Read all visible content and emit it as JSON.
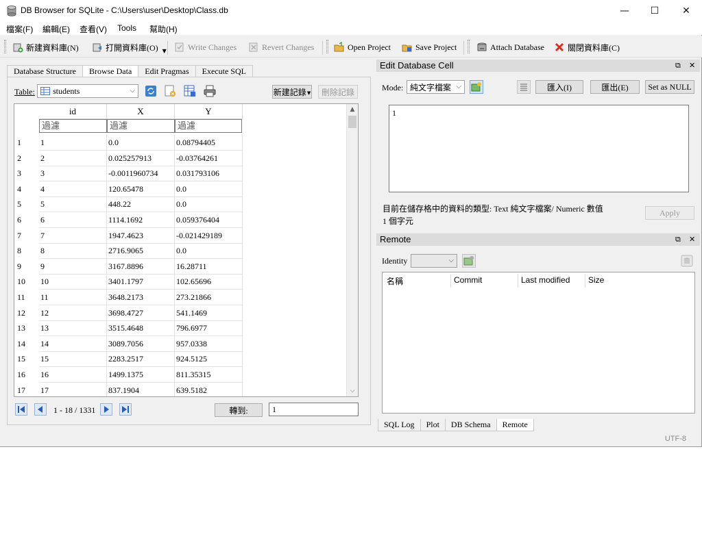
{
  "window": {
    "title": "DB Browser for SQLite - C:\\Users\\user\\Desktop\\Class.db",
    "minimize": "—",
    "maximize": "☐",
    "close": "✕"
  },
  "menu": [
    "檔案(F)",
    "編輯(E)",
    "查看(V)",
    "Tools",
    "幫助(H)"
  ],
  "toolbar": {
    "new_db": "新建資料庫(N)",
    "open_db": "打開資料庫(O)",
    "write_changes": "Write Changes",
    "revert_changes": "Revert Changes",
    "open_project": "Open Project",
    "save_project": "Save Project",
    "attach_db": "Attach Database",
    "close_db": "關閉資料庫(C)"
  },
  "tabs": [
    "Database Structure",
    "Browse Data",
    "Edit Pragmas",
    "Execute SQL"
  ],
  "active_tab": "Browse Data",
  "browse": {
    "table_label": "Table:",
    "table_value": "students",
    "new_record": "新建記錄",
    "delete_record": "刪除記錄",
    "columns": [
      "id",
      "X",
      "Y"
    ],
    "filter_placeholder": "過濾",
    "rows": [
      {
        "n": "1",
        "id": "1",
        "x": "0.0",
        "y": "0.08794405"
      },
      {
        "n": "2",
        "id": "2",
        "x": "0.025257913",
        "y": "-0.03764261"
      },
      {
        "n": "3",
        "id": "3",
        "x": "-0.0011960734",
        "y": "0.031793106"
      },
      {
        "n": "4",
        "id": "4",
        "x": "120.65478",
        "y": "0.0"
      },
      {
        "n": "5",
        "id": "5",
        "x": "448.22",
        "y": "0.0"
      },
      {
        "n": "6",
        "id": "6",
        "x": "1114.1692",
        "y": "0.059376404"
      },
      {
        "n": "7",
        "id": "7",
        "x": "1947.4623",
        "y": "-0.021429189"
      },
      {
        "n": "8",
        "id": "8",
        "x": "2716.9065",
        "y": "0.0"
      },
      {
        "n": "9",
        "id": "9",
        "x": "3167.8896",
        "y": "16.28711"
      },
      {
        "n": "10",
        "id": "10",
        "x": "3401.1797",
        "y": "102.65696"
      },
      {
        "n": "11",
        "id": "11",
        "x": "3648.2173",
        "y": "273.21866"
      },
      {
        "n": "12",
        "id": "12",
        "x": "3698.4727",
        "y": "541.1469"
      },
      {
        "n": "13",
        "id": "13",
        "x": "3515.4648",
        "y": "796.6977"
      },
      {
        "n": "14",
        "id": "14",
        "x": "3089.7056",
        "y": "957.0338"
      },
      {
        "n": "15",
        "id": "15",
        "x": "2283.2517",
        "y": "924.5125"
      },
      {
        "n": "16",
        "id": "16",
        "x": "1499.1375",
        "y": "811.35315"
      },
      {
        "n": "17",
        "id": "17",
        "x": "837.1904",
        "y": "639.5182"
      }
    ],
    "page_info": "1 - 18 / 1331",
    "goto_label": "轉到:",
    "goto_value": "1"
  },
  "edit_cell": {
    "title": "Edit Database Cell",
    "mode_label": "Mode:",
    "mode_value": "純文字檔案",
    "import": "匯入(I)",
    "export": "匯出(E)",
    "set_null": "Set as NULL",
    "content": "1",
    "type_info": "目前在儲存格中的資料的類型: Text 純文字檔案/ Numeric 數值",
    "char_count": "1 個字元",
    "apply": "Apply"
  },
  "remote": {
    "title": "Remote",
    "identity_label": "Identity",
    "columns": [
      "名稱",
      "Commit",
      "Last modified",
      "Size"
    ]
  },
  "bottom_tabs": [
    "SQL Log",
    "Plot",
    "DB Schema",
    "Remote"
  ],
  "active_bottom_tab": "Remote",
  "status_encoding": "UTF-8"
}
